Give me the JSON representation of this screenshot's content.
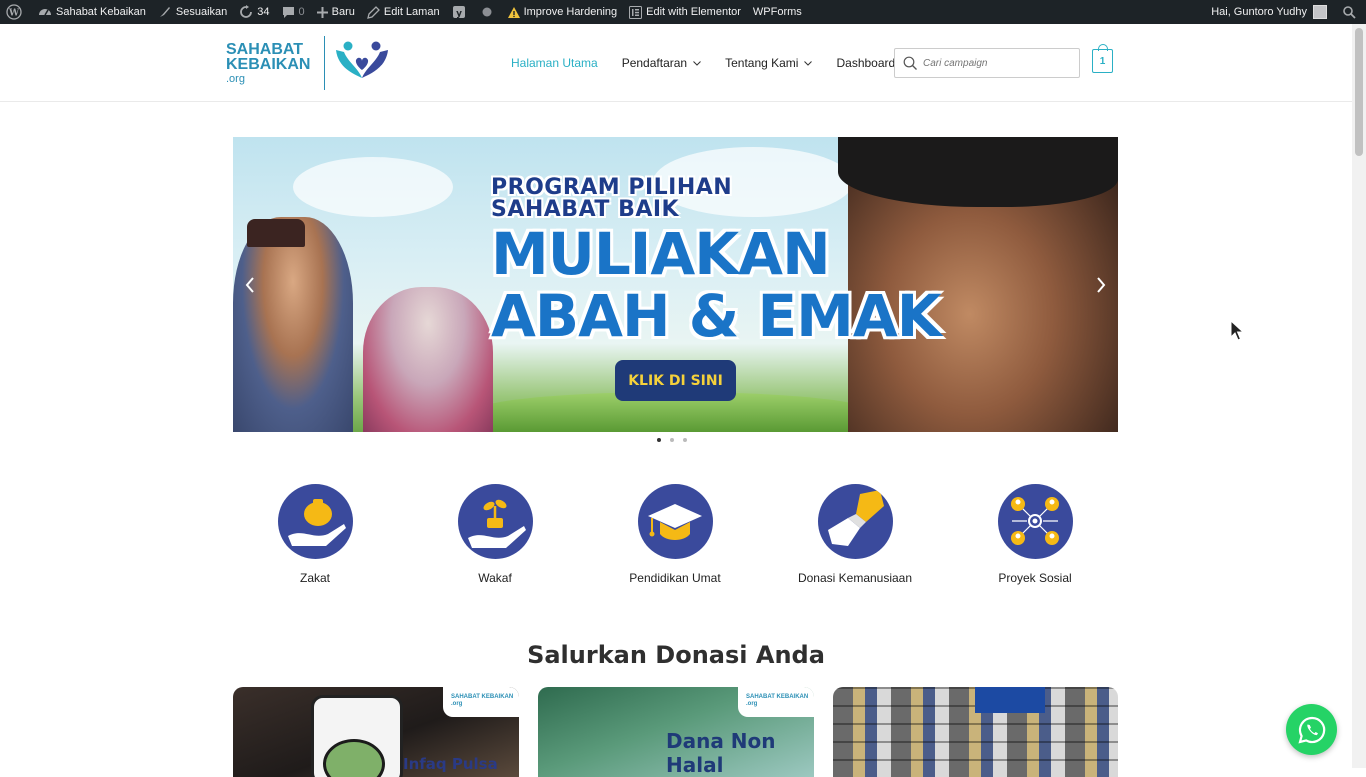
{
  "admin_bar": {
    "site_name": "Sahabat Kebaikan",
    "customize": "Sesuaikan",
    "updates_count": "34",
    "comments_count": "0",
    "new": "Baru",
    "edit_page": "Edit Laman",
    "improve_hardening": "Improve Hardening",
    "edit_elementor": "Edit with Elementor",
    "wpforms": "WPForms",
    "greeting": "Hai, Guntoro Yudhy"
  },
  "logo": {
    "line1": "SAHABAT",
    "line2": "KEBAIKAN",
    "line3": ".org"
  },
  "nav": {
    "items": [
      {
        "label": "Halaman Utama",
        "active": true
      },
      {
        "label": "Pendaftaran",
        "dropdown": true
      },
      {
        "label": "Tentang Kami",
        "dropdown": true
      },
      {
        "label": "Dashboard"
      }
    ]
  },
  "search": {
    "placeholder": "Cari campaign"
  },
  "cart": {
    "count": "1"
  },
  "slider": {
    "line1": "PROGRAM PILIHAN",
    "line2": "SAHABAT BAIK",
    "headline1": "MULIAKAN",
    "headline2": "ABAH & EMAK",
    "button": "KLIK DI SINI",
    "slides_total": 3,
    "active_slide": 1
  },
  "categories": [
    {
      "label": "Zakat",
      "icon": "money-bag-hand-icon"
    },
    {
      "label": "Wakaf",
      "icon": "plant-hand-icon"
    },
    {
      "label": "Pendidikan Umat",
      "icon": "graduation-cap-icon"
    },
    {
      "label": "Donasi Kemanusiaan",
      "icon": "helping-hands-icon"
    },
    {
      "label": "Proyek Sosial",
      "icon": "network-people-icon"
    }
  ],
  "section_title": "Salurkan Donasi Anda",
  "cards": [
    {
      "badge": "SAHABAT KEBAIKAN .org",
      "text": "Infaq Pulsa"
    },
    {
      "badge": "SAHABAT KEBAIKAN .org",
      "text": "Dana Non Halal"
    },
    {
      "badge": "",
      "text": ""
    }
  ],
  "colors": {
    "accent": "#2ab0c5",
    "brand_blue": "#3a4a9c",
    "admin_bar": "#1d2327",
    "whatsapp": "#25d366"
  }
}
